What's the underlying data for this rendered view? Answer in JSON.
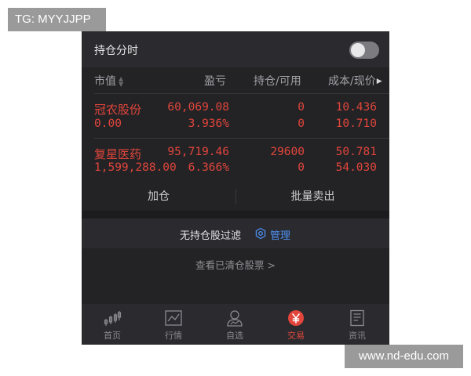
{
  "watermarks": {
    "top": "TG: MYYJJPP",
    "bottom": "www.nd-edu.com"
  },
  "holdings": {
    "title": "持仓分时",
    "toggle_on": false,
    "columns": {
      "market_value": "市值",
      "pnl": "盈亏",
      "position": "持仓/可用",
      "cost": "成本/现价"
    },
    "rows": [
      {
        "name": "冠农股份",
        "market_value": "0.00",
        "pnl": "60,069.08",
        "pnl_pct": "3.936%",
        "position": "0",
        "available": "0",
        "cost": "10.436",
        "price": "10.710"
      },
      {
        "name": "复星医药",
        "market_value": "1,599,288.00",
        "pnl": "95,719.46",
        "pnl_pct": "6.366%",
        "position": "29600",
        "available": "0",
        "cost": "50.781",
        "price": "54.030"
      }
    ]
  },
  "actions": {
    "add": "加仓",
    "sell": "批量卖出"
  },
  "filter": {
    "label": "无持仓股过滤",
    "manage": "管理"
  },
  "clear_link": "查看已清仓股票 >",
  "tabs": [
    {
      "label": "首页",
      "icon": "candlestick-icon",
      "active": false
    },
    {
      "label": "行情",
      "icon": "chart-icon",
      "active": false
    },
    {
      "label": "自选",
      "icon": "user-icon",
      "active": false
    },
    {
      "label": "交易",
      "icon": "yen-icon",
      "active": true
    },
    {
      "label": "资讯",
      "icon": "document-icon",
      "active": false
    }
  ],
  "colors": {
    "accent_red": "#e1453b",
    "link_blue": "#4c8ff0",
    "background": "#232326"
  }
}
